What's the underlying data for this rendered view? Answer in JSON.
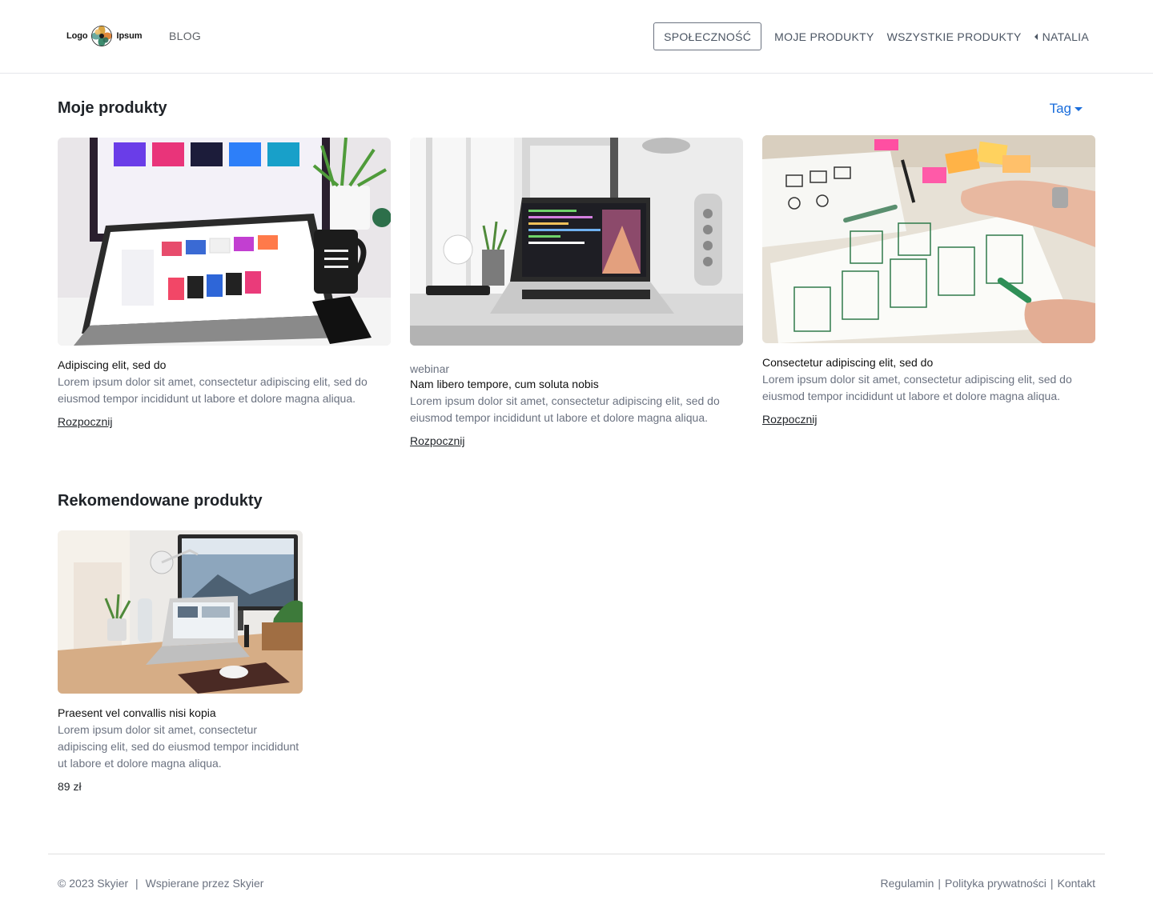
{
  "header": {
    "logo_left": "Logo",
    "logo_right": "Ipsum",
    "blog": "BLOG",
    "community": "SPOŁECZNOŚĆ",
    "my_products": "MOJE PRODUKTY",
    "all_products": "WSZYSTKIE PRODUKTY",
    "user": "NATALIA"
  },
  "my_section": {
    "title": "Moje produkty",
    "tag_label": "Tag",
    "cards": [
      {
        "category": "",
        "title": "Adipiscing elit, sed do",
        "desc": "Lorem ipsum dolor sit amet, consectetur adipiscing elit, sed do eiusmod tempor incididunt ut labore et dolore magna aliqua.",
        "link": "Rozpocznij"
      },
      {
        "category": "webinar",
        "title": "Nam libero tempore, cum soluta nobis",
        "desc": "Lorem ipsum dolor sit amet, consectetur adipiscing elit, sed do eiusmod tempor incididunt ut labore et dolore magna aliqua.",
        "link": "Rozpocznij"
      },
      {
        "category": "",
        "title": "Consectetur adipiscing elit, sed do",
        "desc": "Lorem ipsum dolor sit amet, consectetur adipiscing elit, sed do eiusmod tempor incididunt ut labore et dolore magna aliqua.",
        "link": "Rozpocznij"
      }
    ]
  },
  "recommended": {
    "title": "Rekomendowane produkty",
    "cards": [
      {
        "title": "Praesent vel convallis nisi kopia",
        "desc": "Lorem ipsum dolor sit amet, consectetur adipiscing elit, sed do eiusmod tempor incididunt ut labore et dolore magna aliqua.",
        "price": "89 zł"
      }
    ]
  },
  "footer": {
    "copyright": "© 2023 Skyier",
    "powered": "Wspierane przez Skyier",
    "terms": "Regulamin",
    "privacy": "Polityka prywatności",
    "contact": "Kontakt"
  }
}
